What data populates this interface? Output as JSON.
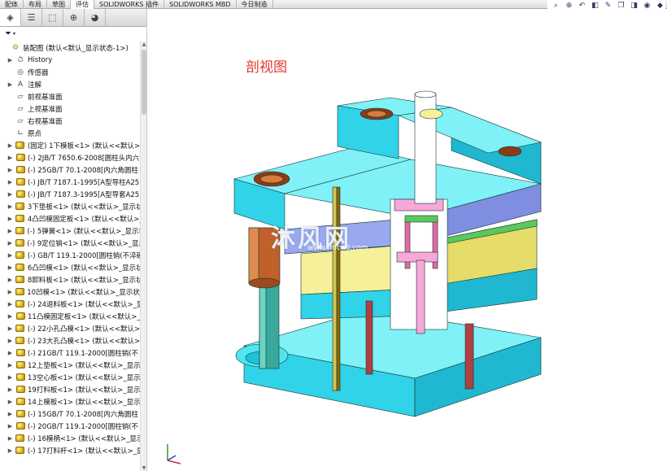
{
  "ribbon": {
    "tabs": [
      "配体",
      "布局",
      "草图",
      "评估",
      "SOLIDWORKS 插件",
      "SOLIDWORKS MBD",
      "今日制造"
    ],
    "active_index": 3
  },
  "view_tools": [
    "zoom-fit-icon",
    "zoom-area-icon",
    "previous-view-icon",
    "section-view-icon",
    "dynamic-annotation-icon",
    "view-orientation-icon",
    "display-style-icon",
    "hide-show-icon",
    "appearance-icon"
  ],
  "panel": {
    "tabs": [
      "feature-manager-icon",
      "property-manager-icon",
      "configuration-manager-icon",
      "dimxpert-icon",
      "display-manager-icon"
    ]
  },
  "tree": [
    {
      "label": "装配图  (默认<默认_显示状态-1>)",
      "icon": "assembly-icon",
      "root": true
    },
    {
      "label": "History",
      "icon": "history-icon",
      "expand": true
    },
    {
      "label": "传感器",
      "icon": "sensor-icon",
      "expand": false
    },
    {
      "label": "注解",
      "icon": "annotation-icon",
      "expand": true
    },
    {
      "label": "前视基准面",
      "icon": "plane-icon",
      "expand": false
    },
    {
      "label": "上视基准面",
      "icon": "plane-icon",
      "expand": false
    },
    {
      "label": "右视基准面",
      "icon": "plane-icon",
      "expand": false
    },
    {
      "label": "原点",
      "icon": "origin-icon",
      "expand": false
    },
    {
      "label": "(固定) 1下模板<1> (默认<<默认>_",
      "icon": "part-icon",
      "expand": true
    },
    {
      "label": "(-) 2JB/T 7650.6-2008[圆柱头内六",
      "icon": "part-icon",
      "expand": true
    },
    {
      "label": "(-) 25GB/T 70.1-2008[内六角圆柱",
      "icon": "part-icon",
      "expand": true
    },
    {
      "label": "(-) JB/T 7187.1-1995[A型导柱A25",
      "icon": "part-icon",
      "expand": true
    },
    {
      "label": "(-) JB/T 7187.3-1995[A型导套A25",
      "icon": "part-icon",
      "expand": true
    },
    {
      "label": "3下垫板<1> (默认<<默认>_显示状",
      "icon": "part-icon",
      "expand": true
    },
    {
      "label": "4凸凹模固定板<1> (默认<<默认>_",
      "icon": "part-icon",
      "expand": true
    },
    {
      "label": "(-) 5弹簧<1> (默认<<默认>_显示状",
      "icon": "part-icon",
      "expand": true
    },
    {
      "label": "(-) 9定位销<1> (默认<<默认>_显示",
      "icon": "part-icon",
      "expand": true
    },
    {
      "label": "(-) GB/T 119.1-2000[圆柱销(不淬硬",
      "icon": "part-icon",
      "expand": true
    },
    {
      "label": "6凸凹模<1> (默认<<默认>_显示状",
      "icon": "part-icon",
      "expand": true
    },
    {
      "label": "8卸料板<1> (默认<<默认>_显示状",
      "icon": "part-icon",
      "expand": true
    },
    {
      "label": "10凹模<1> (默认<<默认>_显示状态",
      "icon": "part-icon",
      "expand": true
    },
    {
      "label": "(-) 24退料板<1> (默认<<默认>_显",
      "icon": "part-icon",
      "expand": true
    },
    {
      "label": "11凸模固定板<1> (默认<<默认>_",
      "icon": "part-icon",
      "expand": true
    },
    {
      "label": "(-) 22小孔凸模<1> (默认<<默认>_",
      "icon": "part-icon",
      "expand": true
    },
    {
      "label": "(-) 23大孔凸模<1> (默认<<默认>_",
      "icon": "part-icon",
      "expand": true
    },
    {
      "label": "(-) 21GB/T 119.1-2000[圆柱销(不",
      "icon": "part-icon",
      "expand": true
    },
    {
      "label": "12上垫板<1> (默认<<默认>_显示",
      "icon": "part-icon",
      "expand": true
    },
    {
      "label": "13空心板<1> (默认<<默认>_显示",
      "icon": "part-icon",
      "expand": true
    },
    {
      "label": "19打料板<1> (默认<<默认>_显示",
      "icon": "part-icon",
      "expand": true
    },
    {
      "label": "14上模板<1> (默认<<默认>_显示",
      "icon": "part-icon",
      "expand": true
    },
    {
      "label": "(-) 15GB/T 70.1-2008[内六角圆柱",
      "icon": "part-icon",
      "expand": true
    },
    {
      "label": "(-) 20GB/T 119.1-2000[圆柱销(不",
      "icon": "part-icon",
      "expand": true
    },
    {
      "label": "(-) 16模柄<1> (默认<<默认>_显示",
      "icon": "part-icon",
      "expand": true
    },
    {
      "label": "(-) 17打料杆<1> (默认<<默认>_显",
      "icon": "part-icon",
      "expand": true
    }
  ],
  "viewport": {
    "caption": "剖视图",
    "watermark": "沐风网",
    "watermark_sub": "www.mfcad.com"
  },
  "colors": {
    "cyan": "#2fe0f0",
    "violet": "#9aa8f0",
    "yellow": "#f6f09a",
    "pink": "#f7a8d8",
    "copper": "#c0602a",
    "green": "#3aa89a",
    "caption": "#e0392b"
  }
}
